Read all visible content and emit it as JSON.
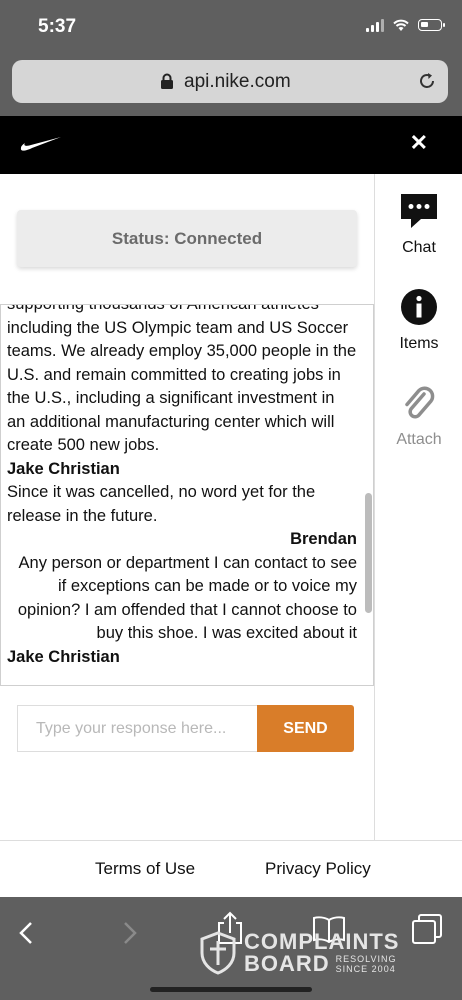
{
  "status_bar": {
    "time": "5:37"
  },
  "browser": {
    "url": "api.nike.com"
  },
  "chat_panel": {
    "status": "Status: Connected",
    "messages": [
      {
        "text": "supporting thousands of American athletes including the US Olympic team and US Soccer teams. We already employ 35,000 people in the U.S. and remain committed to creating jobs in the U.S., including a significant investment in an additional manufacturing center which will create 500 new jobs."
      },
      {
        "sender": "Jake Christian",
        "text": "Since it was cancelled, no word yet for the release in the future."
      },
      {
        "sender": "Brendan",
        "text": "Any person or department I can contact to see if exceptions can be made or to voice my opinion? I am offended that I cannot choose to buy this shoe. I was excited about it"
      },
      {
        "sender": "Jake Christian"
      }
    ],
    "input_placeholder": "Type your response here...",
    "send_label": "SEND"
  },
  "sidebar": {
    "items": [
      {
        "label": "Chat",
        "icon": "chat-bubble-icon"
      },
      {
        "label": "Items",
        "icon": "info-icon"
      },
      {
        "label": "Attach",
        "icon": "paperclip-icon"
      }
    ]
  },
  "footer": {
    "terms": "Terms of Use",
    "privacy": "Privacy Policy"
  },
  "watermark": {
    "line1": "COMPLAINTS",
    "line2": "BOARD",
    "line3": "RESOLVING",
    "line4": "SINCE 2004"
  },
  "colors": {
    "accent": "#d97d29",
    "header": "#000000",
    "chrome": "#5f5f5f"
  }
}
